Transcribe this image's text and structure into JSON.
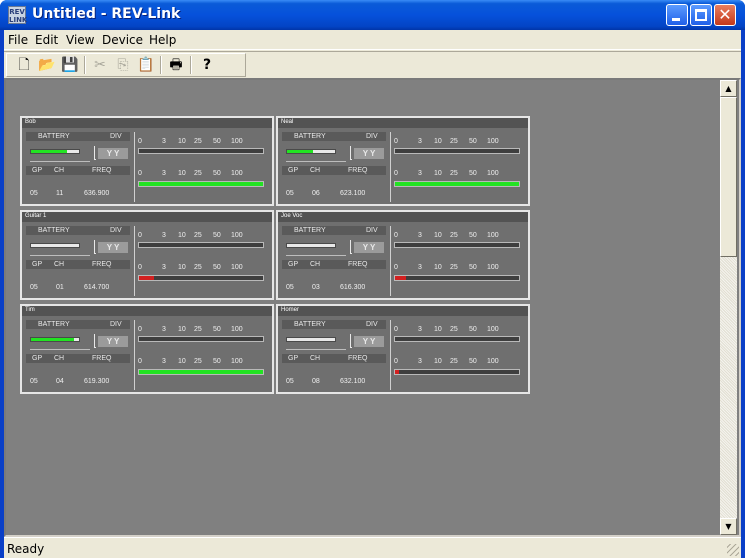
{
  "window": {
    "title": "Untitled - REV-Link",
    "icon_text": "REV LINK",
    "minimize_icon": "minimize-icon",
    "maximize_icon": "maximize-icon",
    "close_icon": "close-icon",
    "close_glyph": "✕"
  },
  "menu": [
    "File",
    "Edit",
    "View",
    "Device",
    "Help"
  ],
  "toolbar": {
    "buttons": [
      {
        "name": "new-icon",
        "glyph": "🗋",
        "enabled": true
      },
      {
        "name": "open-icon",
        "glyph": "📂",
        "enabled": true
      },
      {
        "name": "save-icon",
        "glyph": "💾",
        "enabled": true
      },
      {
        "name": "cut-icon",
        "glyph": "✂",
        "enabled": false
      },
      {
        "name": "copy-icon",
        "glyph": "⎘",
        "enabled": false
      },
      {
        "name": "paste-icon",
        "glyph": "📋",
        "enabled": false
      },
      {
        "name": "print-icon",
        "glyph": "🖶",
        "enabled": true
      },
      {
        "name": "help-icon",
        "glyph": "?",
        "enabled": true
      }
    ]
  },
  "labels": {
    "battery": "BATTERY",
    "div": "DIV",
    "yy": "Y Y",
    "gp": "GP",
    "ch": "CH",
    "freq": "FREQ",
    "scale": [
      "0",
      "3",
      "10",
      "25",
      "50",
      "100"
    ]
  },
  "channels": [
    {
      "name": "Bob",
      "gp": "05",
      "ch": "11",
      "freq": "636.900",
      "battery_level": 0.75,
      "battery_color": "#22e322",
      "rf_level": 1.0,
      "rf_color": "#22e322"
    },
    {
      "name": "Neal",
      "gp": "05",
      "ch": "06",
      "freq": "623.100",
      "battery_level": 0.55,
      "battery_color": "#22e322",
      "rf_level": 1.0,
      "rf_color": "#22e322"
    },
    {
      "name": "Guitar 1",
      "gp": "05",
      "ch": "01",
      "freq": "614.700",
      "battery_level": 0.0,
      "battery_color": "#22e322",
      "rf_level": 0.12,
      "rf_color": "#d22020"
    },
    {
      "name": "Joe Voc",
      "gp": "05",
      "ch": "03",
      "freq": "616.300",
      "battery_level": 0.0,
      "battery_color": "#22e322",
      "rf_level": 0.09,
      "rf_color": "#d22020"
    },
    {
      "name": "Tim",
      "gp": "05",
      "ch": "04",
      "freq": "619.300",
      "battery_level": 0.9,
      "battery_color": "#22e322",
      "rf_level": 1.0,
      "rf_color": "#22e322"
    },
    {
      "name": "Homer",
      "gp": "05",
      "ch": "08",
      "freq": "632.100",
      "battery_level": 0.0,
      "battery_color": "#22e322",
      "rf_level": 0.03,
      "rf_color": "#d22020"
    }
  ],
  "scrollbar": {
    "up_glyph": "▲",
    "down_glyph": "▼"
  },
  "status": "Ready"
}
